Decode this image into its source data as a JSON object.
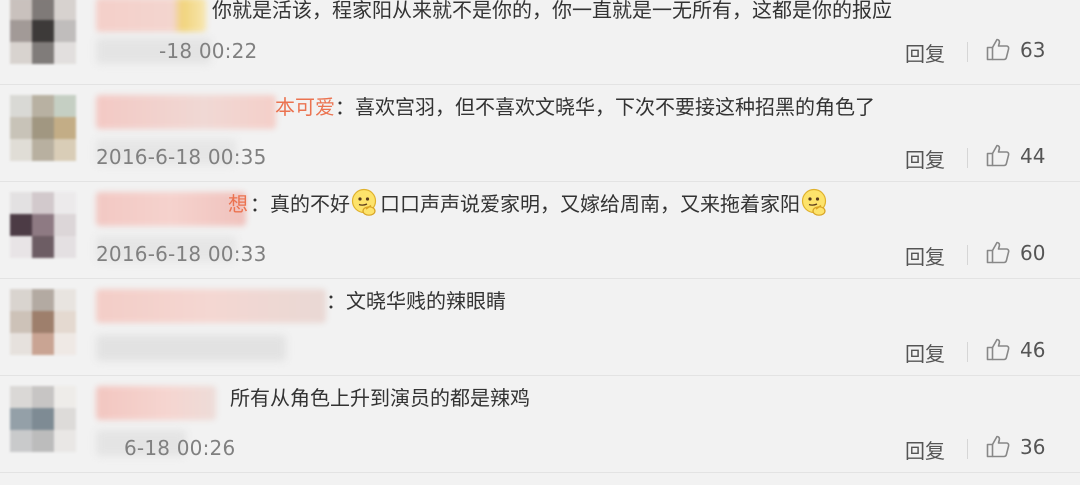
{
  "comments": [
    {
      "username": "",
      "text": "你就是活该，程家阳从来就不是你的，你一直就是一无所有，这都是你的报应",
      "time": "-18 00:22",
      "reply_label": "回复",
      "likes": "63",
      "avatar_colors": [
        "#c9c1bd",
        "#7f7a78",
        "#d7d2cf",
        "#a29a97",
        "#3d3a39",
        "#c0bdbc",
        "#d8d3cf",
        "#807c7a",
        "#e2dfde"
      ]
    },
    {
      "username": "本可爱",
      "text": "：喜欢宫羽，但不喜欢文晓华，下次不要接这种招黑的角色了",
      "time": "2016-6-18 00:35",
      "reply_label": "回复",
      "likes": "44",
      "avatar_colors": [
        "#d9d9d5",
        "#b8b1a2",
        "#c5cfc3",
        "#c8c3b8",
        "#a19781",
        "#c3ad86",
        "#e0ddd6",
        "#b8b0a0",
        "#d9cdb7"
      ]
    },
    {
      "username": "想",
      "text_before_emoji": "：真的不好",
      "text_middle": "口口声声说爱家明，又嫁给周南，又来拖着家阳",
      "time": "2016-6-18 00:33",
      "reply_label": "回复",
      "likes": "60",
      "avatar_colors": [
        "#e3e1e2",
        "#d2c9cc",
        "#eceaeb",
        "#4c3b45",
        "#8e7a83",
        "#dcd6d8",
        "#e8e4e6",
        "#6d5d64",
        "#e4e0e2"
      ]
    },
    {
      "username": "",
      "text": "：文晓华贱的辣眼睛",
      "time": "",
      "reply_label": "回复",
      "likes": "46",
      "avatar_colors": [
        "#d9d4cf",
        "#b3aaa2",
        "#e8e4e0",
        "#cdc2b8",
        "#9e7f6c",
        "#e4d9d0",
        "#e6e1dd",
        "#c9a493",
        "#efe9e5"
      ]
    },
    {
      "username": "",
      "text": "所有从角色上升到演员的都是辣鸡",
      "time": "6-18 00:26",
      "reply_label": "回复",
      "likes": "36",
      "avatar_colors": [
        "#dad8d6",
        "#c7c5c4",
        "#eeece9",
        "#94a0a8",
        "#7e8b94",
        "#dddbd9",
        "#c9cacb",
        "#bcbcbc",
        "#e9e7e5"
      ]
    }
  ]
}
